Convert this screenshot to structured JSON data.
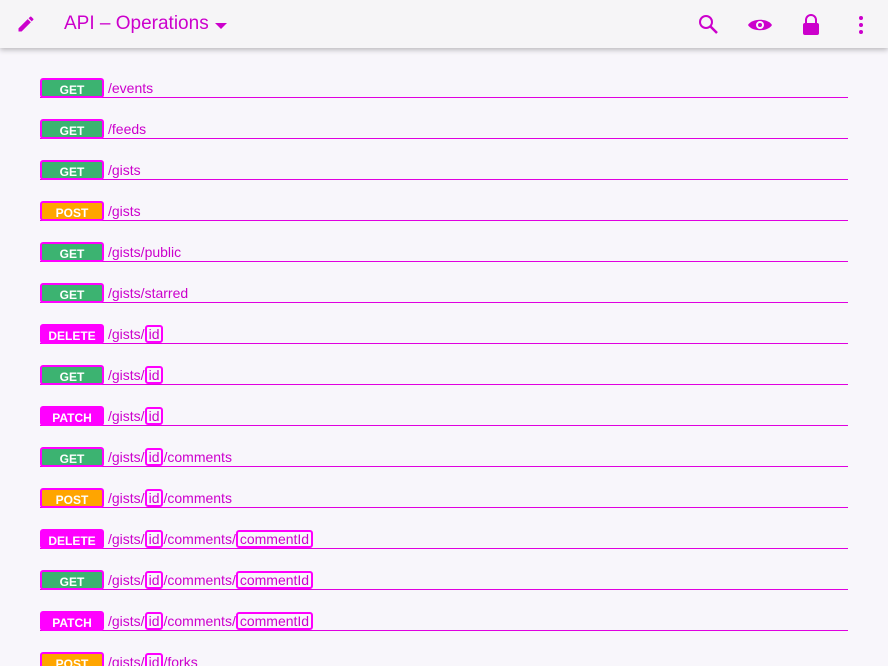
{
  "toolbar": {
    "title": "API – Operations",
    "icons": [
      "edit-icon",
      "search-icon",
      "eye-icon",
      "lock-icon",
      "more-vert-icon"
    ]
  },
  "operations": [
    {
      "method": "GET",
      "segments": [
        {
          "text": "/events",
          "param": false
        }
      ]
    },
    {
      "method": "GET",
      "segments": [
        {
          "text": "/feeds",
          "param": false
        }
      ]
    },
    {
      "method": "GET",
      "segments": [
        {
          "text": "/gists",
          "param": false
        }
      ]
    },
    {
      "method": "POST",
      "segments": [
        {
          "text": "/gists",
          "param": false
        }
      ]
    },
    {
      "method": "GET",
      "segments": [
        {
          "text": "/gists/public",
          "param": false
        }
      ]
    },
    {
      "method": "GET",
      "segments": [
        {
          "text": "/gists/starred",
          "param": false
        }
      ]
    },
    {
      "method": "DELETE",
      "segments": [
        {
          "text": "/gists/",
          "param": false
        },
        {
          "text": "id",
          "param": true
        }
      ]
    },
    {
      "method": "GET",
      "segments": [
        {
          "text": "/gists/",
          "param": false
        },
        {
          "text": "id",
          "param": true
        }
      ]
    },
    {
      "method": "PATCH",
      "segments": [
        {
          "text": "/gists/",
          "param": false
        },
        {
          "text": "id",
          "param": true
        }
      ]
    },
    {
      "method": "GET",
      "segments": [
        {
          "text": "/gists/",
          "param": false
        },
        {
          "text": "id",
          "param": true
        },
        {
          "text": "/comments",
          "param": false
        }
      ]
    },
    {
      "method": "POST",
      "segments": [
        {
          "text": "/gists/",
          "param": false
        },
        {
          "text": "id",
          "param": true
        },
        {
          "text": "/comments",
          "param": false
        }
      ]
    },
    {
      "method": "DELETE",
      "segments": [
        {
          "text": "/gists/",
          "param": false
        },
        {
          "text": "id",
          "param": true
        },
        {
          "text": "/comments/",
          "param": false
        },
        {
          "text": "commentId",
          "param": true
        }
      ]
    },
    {
      "method": "GET",
      "segments": [
        {
          "text": "/gists/",
          "param": false
        },
        {
          "text": "id",
          "param": true
        },
        {
          "text": "/comments/",
          "param": false
        },
        {
          "text": "commentId",
          "param": true
        }
      ]
    },
    {
      "method": "PATCH",
      "segments": [
        {
          "text": "/gists/",
          "param": false
        },
        {
          "text": "id",
          "param": true
        },
        {
          "text": "/comments/",
          "param": false
        },
        {
          "text": "commentId",
          "param": true
        }
      ]
    },
    {
      "method": "POST",
      "segments": [
        {
          "text": "/gists/",
          "param": false
        },
        {
          "text": "id",
          "param": true
        },
        {
          "text": "/forks",
          "param": false
        }
      ]
    }
  ],
  "colors": {
    "accent": "#cc00cc",
    "get": "#3cb371",
    "post": "#ffa500",
    "delete": "#ff00ff",
    "patch": "#ff00ff"
  }
}
